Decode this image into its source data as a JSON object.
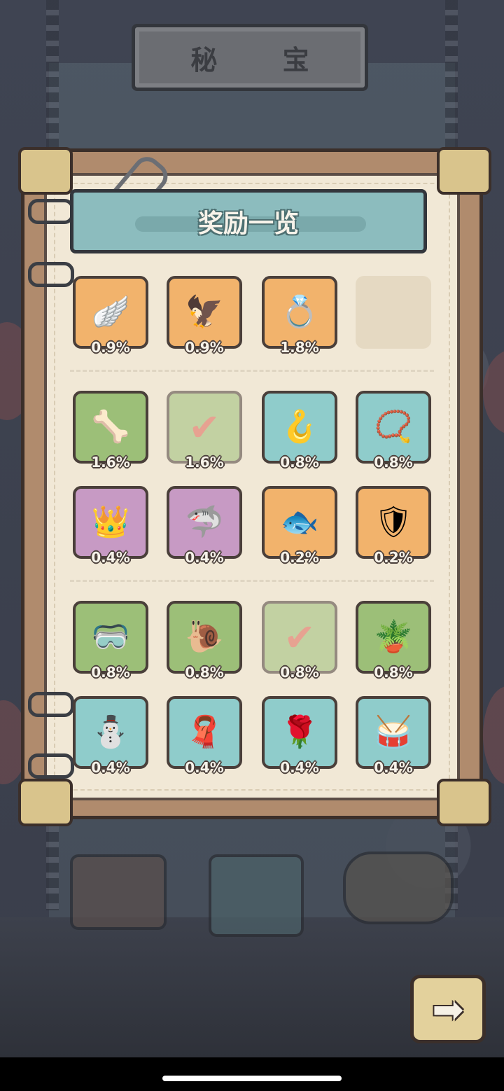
{
  "header": {
    "title": "秘 宝"
  },
  "panel": {
    "title": "奖励一览"
  },
  "colors": {
    "orange": "#f2b36c",
    "green": "#9cbf78",
    "teal": "#8fcccb",
    "purple": "#c79ac4",
    "empty": "#e5d9c2"
  },
  "rewards": [
    {
      "icon": "winged-helmet-icon",
      "glyph": "🪽",
      "rarity": "orange",
      "percent": "0.9%"
    },
    {
      "icon": "dark-wing-helmet-icon",
      "glyph": "🦅",
      "rarity": "orange",
      "percent": "0.9%"
    },
    {
      "icon": "gem-ring-icon",
      "glyph": "💍",
      "rarity": "orange",
      "percent": "1.8%"
    },
    {
      "icon": "empty-slot",
      "glyph": "",
      "rarity": "empty",
      "percent": ""
    },
    {
      "icon": "bone-armor-icon",
      "glyph": "🦴",
      "rarity": "green",
      "percent": "1.6%"
    },
    {
      "icon": "check-mark-icon",
      "glyph": "✔",
      "rarity": "green",
      "percent": "1.6%",
      "collected": true
    },
    {
      "icon": "hook-icon",
      "glyph": "🪝",
      "rarity": "teal",
      "percent": "0.8%"
    },
    {
      "icon": "fang-necklace-icon",
      "glyph": "📿",
      "rarity": "teal",
      "percent": "0.8%"
    },
    {
      "icon": "bird-crown-icon",
      "glyph": "👑",
      "rarity": "purple",
      "percent": "0.4%"
    },
    {
      "icon": "shark-gauntlet-icon",
      "glyph": "🦈",
      "rarity": "purple",
      "percent": "0.4%"
    },
    {
      "icon": "fishbone-sword-icon",
      "glyph": "🐟",
      "rarity": "orange",
      "percent": "0.2%"
    },
    {
      "icon": "heavy-armor-icon",
      "glyph": "🛡",
      "rarity": "orange",
      "percent": "0.2%"
    },
    {
      "icon": "goggles-icon",
      "glyph": "🥽",
      "rarity": "green",
      "percent": "0.8%"
    },
    {
      "icon": "snail-helmet-icon",
      "glyph": "🐌",
      "rarity": "green",
      "percent": "0.8%"
    },
    {
      "icon": "check-mark-icon",
      "glyph": "✔",
      "rarity": "green",
      "percent": "0.8%",
      "collected": true
    },
    {
      "icon": "plant-jar-icon",
      "glyph": "🪴",
      "rarity": "green",
      "percent": "0.8%"
    },
    {
      "icon": "snowman-head-icon",
      "glyph": "⛄",
      "rarity": "teal",
      "percent": "0.4%"
    },
    {
      "icon": "red-scarf-icon",
      "glyph": "🧣",
      "rarity": "teal",
      "percent": "0.4%"
    },
    {
      "icon": "rose-icon",
      "glyph": "🌹",
      "rarity": "teal",
      "percent": "0.4%"
    },
    {
      "icon": "star-drum-icon",
      "glyph": "🥁",
      "rarity": "teal",
      "percent": "0.4%"
    }
  ],
  "footer": {
    "next_icon": "arrow-right-icon",
    "next_glyph": "➡"
  }
}
